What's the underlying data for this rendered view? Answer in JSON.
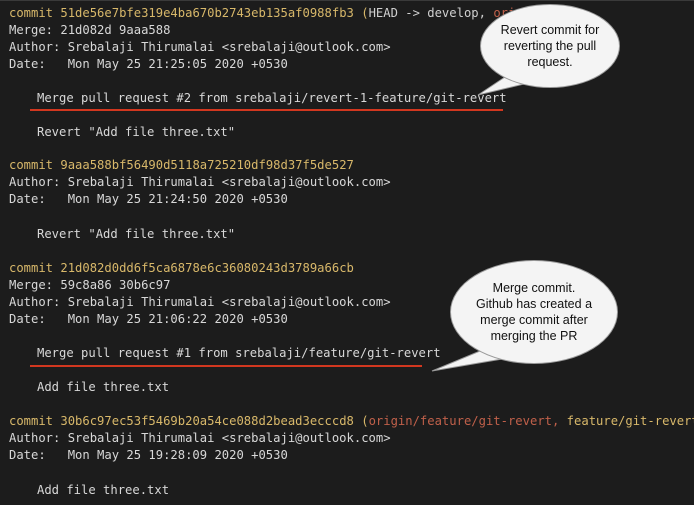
{
  "log": {
    "entries": [
      {
        "commit_label": "commit",
        "hash": "51de56e7bfe319e4ba670b2743eb135af0988fb3",
        "refs": {
          "open": "(",
          "head": "HEAD -> develop,",
          "origin": "origin"
        },
        "merge_line": "Merge: 21d082d 9aaa588",
        "author_line": "Author: Srebalaji Thirumalai <srebalaji@outlook.com>",
        "date_line": "Date:   Mon May 25 21:25:05 2020 +0530",
        "message": "Merge pull request #2 from srebalaji/revert-1-feature/git-revert",
        "body": "Revert \"Add file three.txt\""
      },
      {
        "commit_label": "commit",
        "hash": "9aaa588bf56490d5118a725210df98d37f5de527",
        "author_line": "Author: Srebalaji Thirumalai <srebalaji@outlook.com>",
        "date_line": "Date:   Mon May 25 21:24:50 2020 +0530",
        "message": "Revert \"Add file three.txt\""
      },
      {
        "commit_label": "commit",
        "hash": "21d082d0dd6f5ca6878e6c36080243d3789a66cb",
        "merge_line": "Merge: 59c8a86 30b6c97",
        "author_line": "Author: Srebalaji Thirumalai <srebalaji@outlook.com>",
        "date_line": "Date:   Mon May 25 21:06:22 2020 +0530",
        "message": "Merge pull request #1 from srebalaji/feature/git-revert",
        "body": "Add file three.txt"
      },
      {
        "commit_label": "commit",
        "hash": "30b6c97ec53f5469b20a54ce088d2bead3ecccd8",
        "refs": {
          "open": "(",
          "origin": "origin/feature/git-revert,",
          "branch": " feature/git-revert",
          "close": ")"
        },
        "author_line": "Author: Srebalaji Thirumalai <srebalaji@outlook.com>",
        "date_line": "Date:   Mon May 25 19:28:09 2020 +0530",
        "message": "Add file three.txt"
      }
    ]
  },
  "callouts": {
    "revert": {
      "lines": [
        "Revert commit for",
        "reverting the pull",
        "request."
      ]
    },
    "merge": {
      "lines": [
        "Merge commit.",
        "Github has created a",
        "merge commit after",
        "merging the PR"
      ]
    }
  },
  "colors": {
    "background": "#1c1c1c",
    "text": "#d8d8d8",
    "hash": "#d8b86a",
    "origin_ref": "#c0604a",
    "underline": "#d2371f",
    "callout_bg": "#f4f4f4"
  }
}
